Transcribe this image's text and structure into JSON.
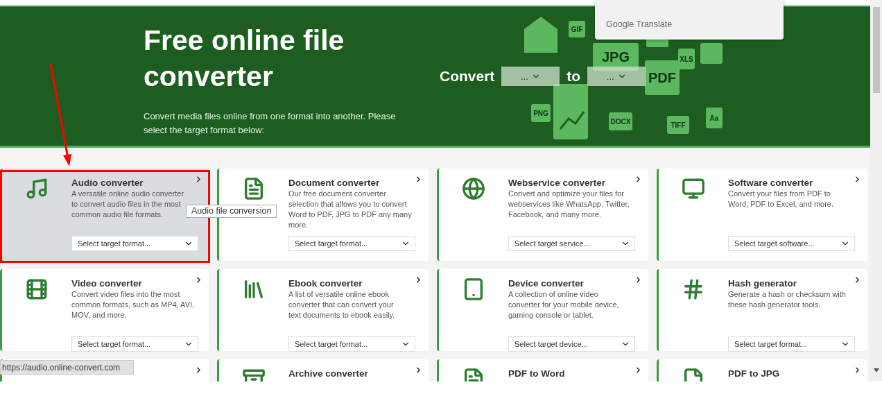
{
  "translate_popup": {
    "label": "Google Translate"
  },
  "hero": {
    "title": "Free online file converter",
    "subtitle": "Convert media files online from one format into another. Please select the target format below:",
    "convert_label": "Convert",
    "from_select": "...",
    "to_label": "to",
    "to_select": "...",
    "format_labels": [
      "GIF",
      "JPG",
      "XLS",
      "PDF",
      "PNG",
      "DOCX",
      "TIFF",
      "Aa"
    ]
  },
  "cards": [
    {
      "title": "Audio converter",
      "description": [
        "A versatile online audio converter",
        "to convert audio files in the most",
        "common audio file formats."
      ],
      "select": "Select target format...",
      "selected": true
    },
    {
      "title": "Document converter",
      "description": [
        "Our free document converter",
        "selection that allows you to convert",
        "Word to PDF, JPG to PDF any many",
        "more."
      ],
      "select": "Select target format...",
      "selected": false
    },
    {
      "title": "Webservice converter",
      "description": [
        "Convert and optimize your files for",
        "webservices like WhatsApp, Twitter,",
        "Facebook, and many more."
      ],
      "select": "Select target service...",
      "selected": false
    },
    {
      "title": "Software converter",
      "description": [
        "Convert your files from PDF to",
        "Word, PDF to Excel, and more."
      ],
      "select": "Select target software...",
      "selected": false
    },
    {
      "title": "Video converter",
      "description": [
        "Convert video files into the most",
        "common formats, such as MP4, AVI,",
        "MOV, and more."
      ],
      "select": "Select target format...",
      "selected": false
    },
    {
      "title": "Ebook converter",
      "description": [
        "A list of versatile online ebook",
        "converter that can convert your",
        "text documents to ebook easily."
      ],
      "select": "Select target format...",
      "selected": false
    },
    {
      "title": "Device converter",
      "description": [
        "A collection of online video",
        "converter for your mobile device,",
        "gaming console or tablet."
      ],
      "select": "Select target device...",
      "selected": false
    },
    {
      "title": "Hash generator",
      "description": [
        "Generate a hash or checksum with",
        "these hash generator tools."
      ],
      "select": "Select target format...",
      "selected": false
    },
    {
      "selected": false
    },
    {
      "title": "Archive converter",
      "selected": false
    },
    {
      "title": "PDF to Word",
      "selected": false
    },
    {
      "title": "PDF to JPG",
      "selected": false
    }
  ],
  "tooltip": "Audio file conversion",
  "status_url": "https://audio.online-convert.com"
}
